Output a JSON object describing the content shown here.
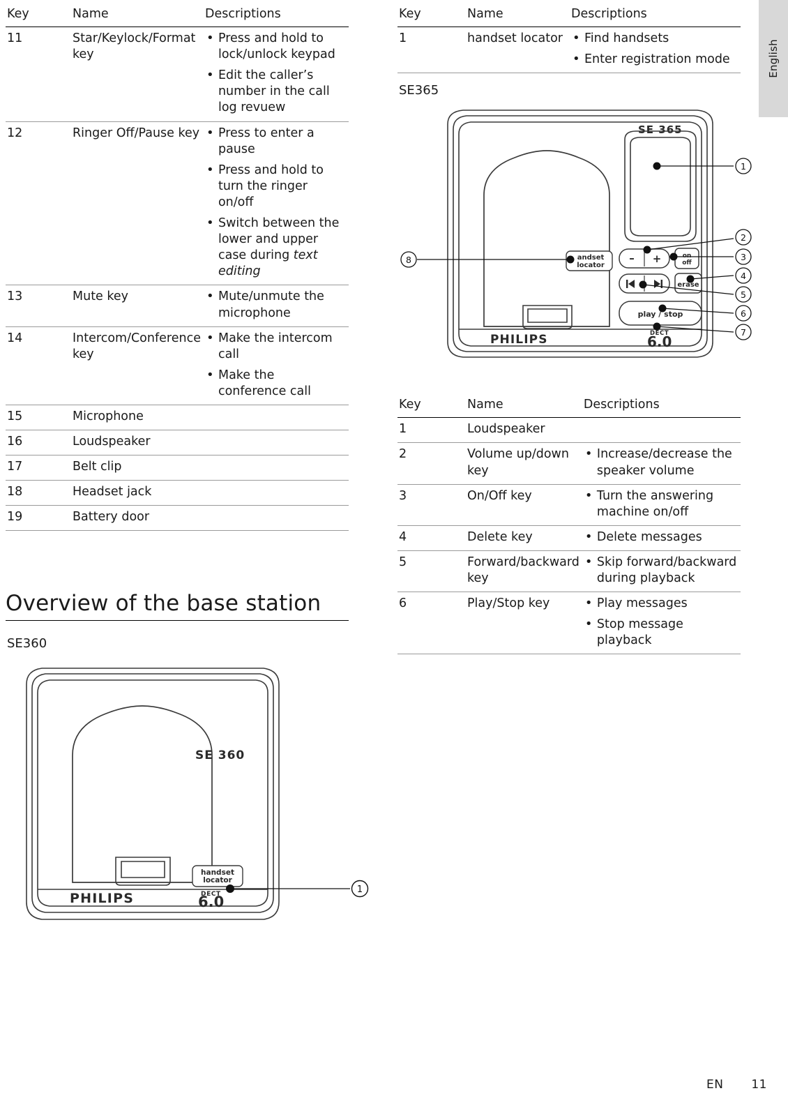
{
  "side_tab": {
    "label": "English"
  },
  "left_column": {
    "table": {
      "headers": [
        "Key",
        "Name",
        "Descriptions"
      ],
      "rows": [
        {
          "key": "11",
          "name": "Star/Keylock/Format key",
          "desc": [
            {
              "text": "Press and hold to lock/unlock keypad",
              "italic": false
            },
            {
              "text": "Edit the caller’s number in the call log revuew",
              "italic": false
            }
          ]
        },
        {
          "key": "12",
          "name": "Ringer Off/Pause key",
          "desc": [
            {
              "text": "Press to enter a pause",
              "italic": false
            },
            {
              "text": "Press and hold to turn the ringer on/off",
              "italic": false
            },
            {
              "text": "Switch between the lower and upper case during ",
              "italic": false,
              "italic_tail": "text editing"
            }
          ]
        },
        {
          "key": "13",
          "name": "Mute key",
          "desc": [
            {
              "text": "Mute/unmute the microphone",
              "italic": false
            }
          ]
        },
        {
          "key": "14",
          "name": "Intercom/Conference key",
          "desc": [
            {
              "text": "Make the intercom call",
              "italic": false
            },
            {
              "text": "Make the conference call",
              "italic": false
            }
          ]
        },
        {
          "key": "15",
          "name": "Microphone",
          "desc": []
        },
        {
          "key": "16",
          "name": "Loudspeaker",
          "desc": []
        },
        {
          "key": "17",
          "name": "Belt clip",
          "desc": []
        },
        {
          "key": "18",
          "name": "Headset jack",
          "desc": []
        },
        {
          "key": "19",
          "name": "Battery door",
          "desc": []
        }
      ]
    },
    "section_title": "Overview of the base station",
    "model_label": "SE360",
    "figure": {
      "brand": "PHILIPS",
      "model_text": "SE 360",
      "dect_small": "DECT",
      "dect_big": "6.0",
      "handset_line1": "handset",
      "handset_line2": "locator",
      "callout": "1"
    }
  },
  "right_column": {
    "table_top": {
      "headers": [
        "Key",
        "Name",
        "Descriptions"
      ],
      "rows": [
        {
          "key": "1",
          "name": "handset locator",
          "desc": [
            {
              "text": "Find handsets"
            },
            {
              "text": "Enter registration mode"
            }
          ]
        }
      ]
    },
    "model_label": "SE365",
    "figure": {
      "brand": "PHILIPS",
      "model_text": "SE 365",
      "dect_small": "DECT",
      "dect_big": "6.0",
      "handset_line1": "handset",
      "handset_line2": "locator",
      "btn_minus": "–",
      "btn_plus": "+",
      "btn_on": "on",
      "btn_off": "off",
      "btn_erase": "erase",
      "btn_play": "play / stop",
      "callouts": [
        "1",
        "2",
        "3",
        "4",
        "5",
        "6",
        "7",
        "8"
      ]
    },
    "table_bottom": {
      "headers": [
        "Key",
        "Name",
        "Descriptions"
      ],
      "rows": [
        {
          "key": "1",
          "name": "Loudspeaker",
          "desc": []
        },
        {
          "key": "2",
          "name": "Volume up/down key",
          "desc": [
            {
              "text": "Increase/decrease the speaker volume"
            }
          ]
        },
        {
          "key": "3",
          "name": "On/Off key",
          "desc": [
            {
              "text": "Turn the answering machine on/off"
            }
          ]
        },
        {
          "key": "4",
          "name": "Delete key",
          "desc": [
            {
              "text": "Delete messages"
            }
          ]
        },
        {
          "key": "5",
          "name": "Forward/backward key",
          "desc": [
            {
              "text": "Skip forward/backward during playback"
            }
          ]
        },
        {
          "key": "6",
          "name": "Play/Stop key",
          "desc": [
            {
              "text": "Play messages"
            },
            {
              "text": "Stop message playback"
            }
          ]
        }
      ]
    }
  },
  "footer": {
    "lang": "EN",
    "page": "11"
  }
}
